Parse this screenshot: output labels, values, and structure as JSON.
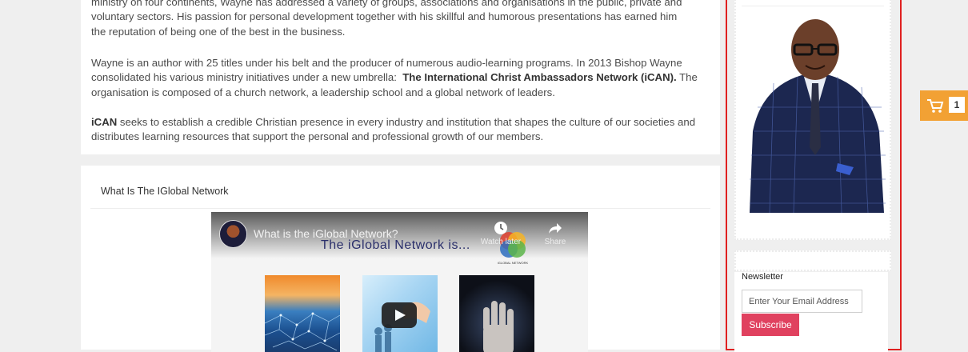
{
  "bio": {
    "paragraph1": {
      "line1": "ministry on four continents, Wayne has addressed a variety of groups, associations and organisations in the public, private and",
      "line2": "voluntary sectors. His passion for personal development together with his skillful and humorous presentations has earned him",
      "line3": "the reputation of being one of the best in the business."
    },
    "paragraph2": {
      "line1": "Wayne is an author with 25 titles under his belt and the producer of numerous audio-learning programs. In 2013 Bishop Wayne",
      "line2_prefix": "consolidated his various ministry initiatives under a new umbrella:  ",
      "line2_bold": "The International Christ Ambassadors Network (iCAN).",
      "line2_suffix": " The",
      "line3": "organisation is composed of a church network, a leadership school and a global network of leaders."
    },
    "paragraph3": {
      "line1_bold": "iCAN",
      "line1_rest": " seeks to establish a credible Christian presence in every industry and institution that shapes the culture of our societies and",
      "line2": "distributes learning resources that support the personal and professional growth of our members."
    }
  },
  "video_section": {
    "title": "What Is The IGlobal Network",
    "player": {
      "video_title": "What is the iGlobal Network?",
      "headline": "The iGlobal Network is...",
      "watch_later_label": "Watch later",
      "share_label": "Share",
      "logo_caption": "iGLOBAL NETWORK"
    }
  },
  "sidebar": {
    "newsletter": {
      "title": "Newsletter",
      "email_placeholder": "Enter Your Email Address",
      "subscribe_label": "Subscribe"
    }
  },
  "cart": {
    "count": "1"
  },
  "colors": {
    "sidebar_border": "#e02020",
    "subscribe_button": "#e0415f",
    "cart_tab": "#f2a134",
    "headline_text": "#2a2f6b"
  },
  "icons": [
    "play-icon",
    "clock-icon",
    "share-icon",
    "cart-icon",
    "channel-avatar",
    "iglobal-logo"
  ]
}
